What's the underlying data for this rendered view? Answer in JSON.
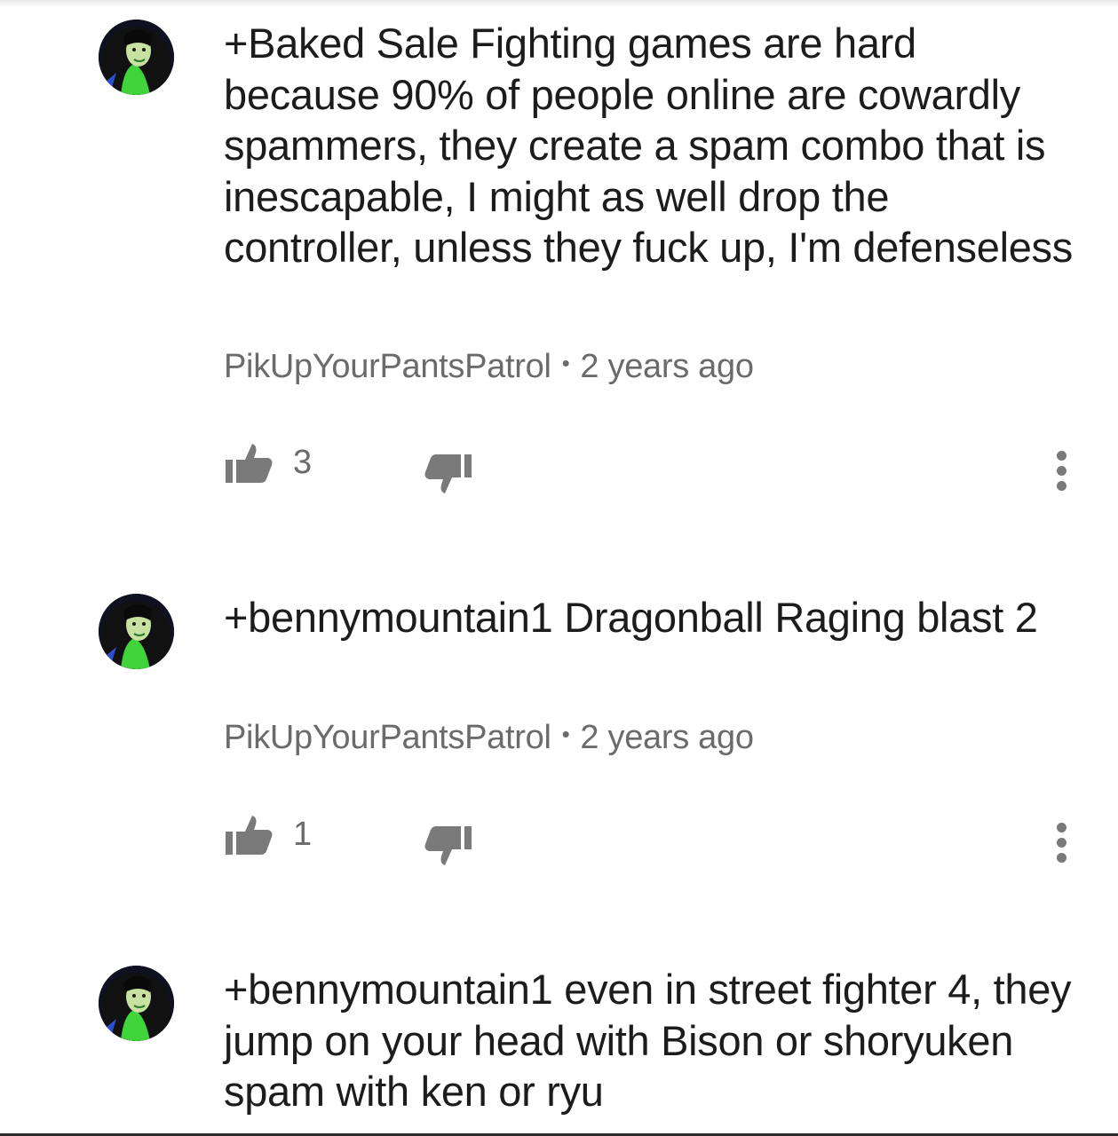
{
  "comments": [
    {
      "text": "+Baked Sale Fighting games are hard because 90% of people online are cowardly spammers, they create a spam combo that is inescapable, I might as well drop the controller, unless they fuck up, I'm defenseless",
      "author": "PikUpYourPantsPatrol",
      "separator": "•",
      "time": "2 years ago",
      "likes": "3"
    },
    {
      "text": "+bennymountain1 Dragonball Raging blast 2",
      "author": "PikUpYourPantsPatrol",
      "separator": "•",
      "time": "2 years ago",
      "likes": "1"
    },
    {
      "text": "+bennymountain1 even in street fighter 4, they jump on your head with Bison or shoryuken spam with ken or ryu",
      "author": "",
      "separator": "",
      "time": "",
      "likes": ""
    }
  ],
  "icons": {
    "like": "thumbs-up-icon",
    "dislike": "thumbs-down-icon",
    "more": "more-vertical-icon"
  },
  "colors": {
    "text": "#1c1c1c",
    "meta": "#6b6b6b",
    "icon": "#7a7a7a",
    "avatar_accent": "#3fd43a"
  }
}
